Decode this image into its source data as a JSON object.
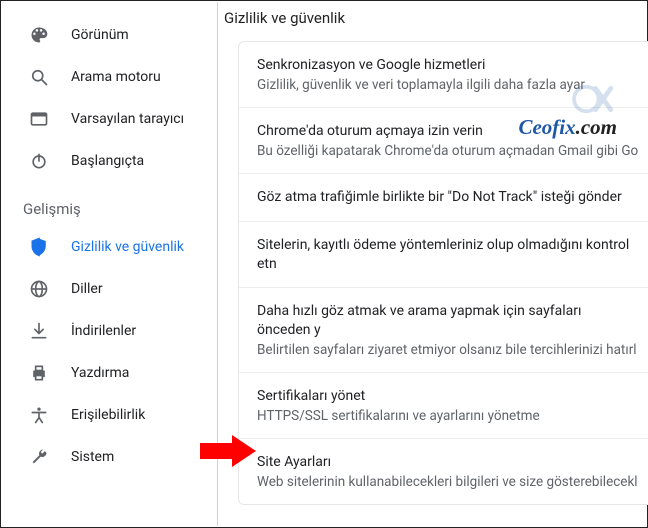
{
  "sidebar": {
    "top": [
      {
        "icon": "palette",
        "label": "Görünüm"
      },
      {
        "icon": "search",
        "label": "Arama motoru"
      },
      {
        "icon": "browser",
        "label": "Varsayılan tarayıcı"
      },
      {
        "icon": "power",
        "label": "Başlangıçta"
      }
    ],
    "advanced_label": "Gelişmiş",
    "advanced": [
      {
        "icon": "shield",
        "label": "Gizlilik ve güvenlik",
        "active": true
      },
      {
        "icon": "globe",
        "label": "Diller"
      },
      {
        "icon": "download",
        "label": "İndirilenler"
      },
      {
        "icon": "print",
        "label": "Yazdırma"
      },
      {
        "icon": "a11y",
        "label": "Erişilebilirlik"
      },
      {
        "icon": "wrench",
        "label": "Sistem"
      }
    ]
  },
  "page": {
    "title": "Gizlilik ve güvenlik",
    "rows": [
      {
        "title": "Senkronizasyon ve Google hizmetleri",
        "sub": "Gizlilik, güvenlik ve veri toplamayla ilgili daha fazla ayar"
      },
      {
        "title": "Chrome'da oturum açmaya izin verin",
        "sub": "Bu özelliği kapatarak Chrome'da oturum açmadan Gmail gibi Go"
      },
      {
        "title": "Göz atma trafiğimle birlikte bir \"Do Not Track\" isteği gönder"
      },
      {
        "title": "Sitelerin, kayıtlı ödeme yöntemleriniz olup olmadığını kontrol etn"
      },
      {
        "title": "Daha hızlı göz atmak ve arama yapmak için sayfaları önceden y",
        "sub": "Belirtilen sayfaları ziyaret etmiyor olsanız bile tercihlerinizi hatırl"
      },
      {
        "title": "Sertifikaları yönet",
        "sub": "HTTPS/SSL sertifikalarını ve ayarlarını yönetme"
      },
      {
        "title": "Site Ayarları",
        "sub": "Web sitelerinin kullanabilecekleri bilgileri ve size gösterebilecekl"
      }
    ]
  },
  "watermark": {
    "text": "Ceofix",
    "suffix": ".com"
  }
}
